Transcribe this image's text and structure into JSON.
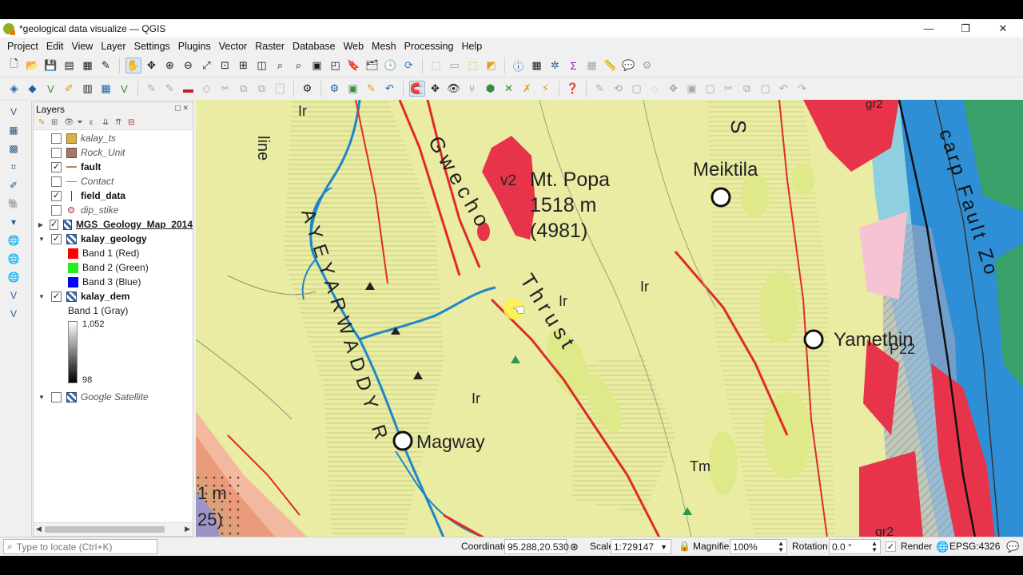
{
  "window": {
    "title": "*geological data visualize — QGIS",
    "controls": {
      "minimize": "—",
      "restore": "❐",
      "close": "✕"
    }
  },
  "menu": [
    "Project",
    "Edit",
    "View",
    "Layer",
    "Settings",
    "Plugins",
    "Vector",
    "Raster",
    "Database",
    "Web",
    "Mesh",
    "Processing",
    "Help"
  ],
  "layers_panel": {
    "title": "Layers",
    "items": [
      {
        "name": "kalay_ts",
        "checked": false,
        "style": "italic",
        "symbol": "#d6b24a"
      },
      {
        "name": "Rock_Unit",
        "checked": false,
        "style": "italic",
        "symbol": "#a27a64"
      },
      {
        "name": "fault",
        "checked": true,
        "style": "bold",
        "symbol": "line-brown"
      },
      {
        "name": "Contact",
        "checked": false,
        "style": "italic",
        "symbol": "line-grey"
      },
      {
        "name": "field_data",
        "checked": true,
        "style": "bold",
        "symbol": "vline"
      },
      {
        "name": "dip_stike",
        "checked": false,
        "style": "italic",
        "symbol": "point-pink"
      },
      {
        "name": "MGS_Geology_Map_2014",
        "checked": true,
        "style": "bold-underline",
        "symbol": "raster"
      },
      {
        "name": "kalay_geology",
        "checked": true,
        "style": "bold",
        "symbol": "raster"
      }
    ],
    "bands": [
      {
        "label": "Band 1 (Red)",
        "color": "#ff0000"
      },
      {
        "label": "Band 2 (Green)",
        "color": "#22ee22"
      },
      {
        "label": "Band 3 (Blue)",
        "color": "#0000ff"
      }
    ],
    "dem": {
      "name": "kalay_dem",
      "checked": true,
      "band_label": "Band 1 (Gray)",
      "max": "1,052",
      "min": "98"
    },
    "satellite": {
      "name": "Google Satellite",
      "checked": false
    }
  },
  "map_labels": {
    "line_top": "line",
    "ir1": "Ir",
    "gwecho": "Gwecho",
    "v2": "v2",
    "popa_name": "Mt. Popa",
    "popa_elev": "1518 m",
    "popa_ft": "(4981)",
    "s": "S",
    "meiktila": "Meiktila",
    "thrust": "Thrust",
    "ir2": "Ir",
    "ir3": "Ir",
    "ir4": "Ir",
    "ayeyarwaddy": "AYEYARWADDY R",
    "magway": "Magway",
    "tm": "Tm",
    "yamethin": "Yamethin",
    "p22": "P22",
    "scarp": "carp Fault Zo",
    "gr2a": "gr2",
    "gr2b": "gr2",
    "leftm": "1 m",
    "left25": "25)"
  },
  "statusbar": {
    "locator_placeholder": "Type to locate (Ctrl+K)",
    "coordinate_label": "Coordinate",
    "coordinate_value": "95.288,20.530",
    "scale_label": "Scale",
    "scale_value": "1:729147",
    "magnifier_label": "Magnifier",
    "magnifier_value": "100%",
    "rotation_label": "Rotation",
    "rotation_value": "0.0 °",
    "render_label": "Render",
    "render_checked": true,
    "crs": "EPSG:4326"
  },
  "colors": {
    "map_base": "#e9eca2",
    "red_unit": "#e8344b",
    "river": "#1d86c9",
    "fault": "#e02a2a"
  }
}
